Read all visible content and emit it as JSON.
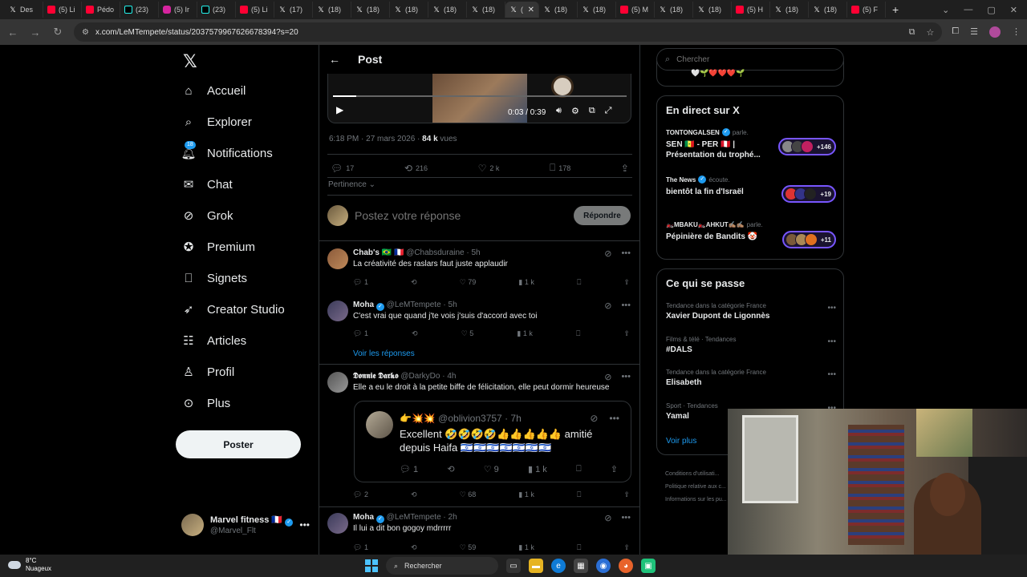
{
  "browser": {
    "tabs": [
      {
        "label": "Des",
        "icon": "x-icon"
      },
      {
        "label": "(5) Li",
        "icon": "youtube-icon"
      },
      {
        "label": "Pédo",
        "icon": "youtube-icon"
      },
      {
        "label": "(23)",
        "icon": "tiktok-icon"
      },
      {
        "label": "(5) Ir",
        "icon": "instagram-icon"
      },
      {
        "label": "(23)",
        "icon": "tiktok-icon"
      },
      {
        "label": "(5) Li",
        "icon": "youtube-icon"
      },
      {
        "label": "(17)",
        "icon": "x-icon"
      },
      {
        "label": "(18)",
        "icon": "x-icon"
      },
      {
        "label": "(18)",
        "icon": "x-icon"
      },
      {
        "label": "(18)",
        "icon": "x-icon"
      },
      {
        "label": "(18)",
        "icon": "x-icon"
      },
      {
        "label": "(18)",
        "icon": "x-icon"
      },
      {
        "label": "(",
        "icon": "x-icon",
        "active": true
      },
      {
        "label": "(18)",
        "icon": "x-icon"
      },
      {
        "label": "(18)",
        "icon": "x-icon"
      },
      {
        "label": "(5) M",
        "icon": "youtube-icon"
      },
      {
        "label": "(18)",
        "icon": "x-icon"
      },
      {
        "label": "(18)",
        "icon": "x-icon"
      },
      {
        "label": "(5) H",
        "icon": "youtube-icon"
      },
      {
        "label": "(18)",
        "icon": "x-icon"
      },
      {
        "label": "(18)",
        "icon": "x-icon"
      },
      {
        "label": "(5) F",
        "icon": "youtube-icon"
      }
    ],
    "url": "x.com/LeMTempete/status/2037579967626678394?s=20"
  },
  "sidebar": {
    "items": [
      {
        "label": "Accueil",
        "icon": "home-icon"
      },
      {
        "label": "Explorer",
        "icon": "search-icon"
      },
      {
        "label": "Notifications",
        "icon": "bell-icon",
        "badge": "18"
      },
      {
        "label": "Chat",
        "icon": "mail-icon"
      },
      {
        "label": "Grok",
        "icon": "grok-icon"
      },
      {
        "label": "Premium",
        "icon": "premium-icon"
      },
      {
        "label": "Signets",
        "icon": "bookmark-icon"
      },
      {
        "label": "Creator Studio",
        "icon": "rocket-icon"
      },
      {
        "label": "Articles",
        "icon": "articles-icon"
      },
      {
        "label": "Profil",
        "icon": "person-icon"
      },
      {
        "label": "Plus",
        "icon": "more-circle-icon"
      }
    ],
    "post_button": "Poster",
    "account": {
      "name": "Marvel fitness 🇫🇷",
      "handle": "@Marvel_Flt"
    }
  },
  "main": {
    "header_title": "Post",
    "video": {
      "time": "0:03 / 0:39",
      "progress": 0.08
    },
    "meta": {
      "time": "6:18 PM · 27 mars 2026 · ",
      "views": "84 k",
      "views_suffix": " vues"
    },
    "stats": {
      "replies": "17",
      "reposts": "216",
      "likes": "2 k",
      "bookmarks": "178"
    },
    "sort_label": "Pertinence",
    "reply_placeholder": "Postez votre réponse",
    "reply_button": "Répondre",
    "see_replies": "Voir les réponses",
    "replies": [
      {
        "name": "Chab's 🇧🇷 🇫🇷",
        "handle": "@Chabsduraine · 5h",
        "text": "La créativité des raslars faut juste applaudir",
        "replies": "1",
        "reposts": "",
        "likes": "79",
        "views": "1 k"
      },
      {
        "name": "Moha",
        "handle": "@LeMTempete · 5h",
        "text": "C'est vrai que quand j'te vois j'suis d'accord avec toi",
        "replies": "1",
        "reposts": "",
        "likes": "5",
        "views": "1 k"
      },
      {
        "name": "𝕯𝖔𝖓𝖓𝖎𝖊 𝕯𝖆𝖗𝖐𝖔",
        "handle": "@DarkyDo · 4h",
        "text": "Elle a eu le droit à la petite biffe de félicitation, elle peut dormir heureuse",
        "replies": "2",
        "reposts": "",
        "likes": "68",
        "views": "1 k"
      },
      {
        "name": "Moha",
        "handle": "@LeMTempete · 2h",
        "text": "Il lui a dit bon gogoy mdrrrrr",
        "replies": "1",
        "reposts": "",
        "likes": "59",
        "views": "1 k"
      }
    ],
    "quote": {
      "head": "👉💥💥 @oblivion3757 · 7h",
      "text": "Excellent 🤣🤣🤣🤣👍👍👍👍👍 amitié depuis Haifa 🇮🇱🇮🇱🇮🇱🇮🇱🇮🇱🇮🇱🇮🇱",
      "replies": "1",
      "likes": "9",
      "views": "1 k"
    }
  },
  "right": {
    "search_placeholder": "Chercher",
    "top_emojis": "🤍🌱❤️❤️❤️🌱",
    "live": {
      "title": "En direct sur X",
      "items": [
        {
          "host": "TONTONGALSEN",
          "action": " parle.",
          "title": "SEN 🇸🇳 - PER 🇵🇪 | Présentation du trophé...",
          "count": "+146"
        },
        {
          "host": "The News",
          "action": " écoute.",
          "title": "bientôt la fin d'Israël",
          "count": "+19"
        },
        {
          "host": "🏍️MBAKU🏍️AHKUT✍🏽✍🏽",
          "action": " parle.",
          "title": "Pépinière de Bandits 🤡",
          "count": "+11"
        }
      ]
    },
    "trends": {
      "title": "Ce qui se passe",
      "items": [
        {
          "meta": "Tendance dans la catégorie France",
          "name": "Xavier Dupont de Ligonnès"
        },
        {
          "meta": "Films & télé · Tendances",
          "name": "#DALS"
        },
        {
          "meta": "Tendance dans la catégorie France",
          "name": "Elisabeth"
        },
        {
          "meta": "Sport · Tendances",
          "name": "Yamal"
        }
      ],
      "see_more": "Voir plus"
    },
    "footer": [
      "Conditions d'utilisati...",
      "Politique relative aux c...",
      "Informations sur les pu..."
    ]
  },
  "taskbar": {
    "temp": "8°C",
    "weather": "Nuageux",
    "search": "Rechercher"
  }
}
